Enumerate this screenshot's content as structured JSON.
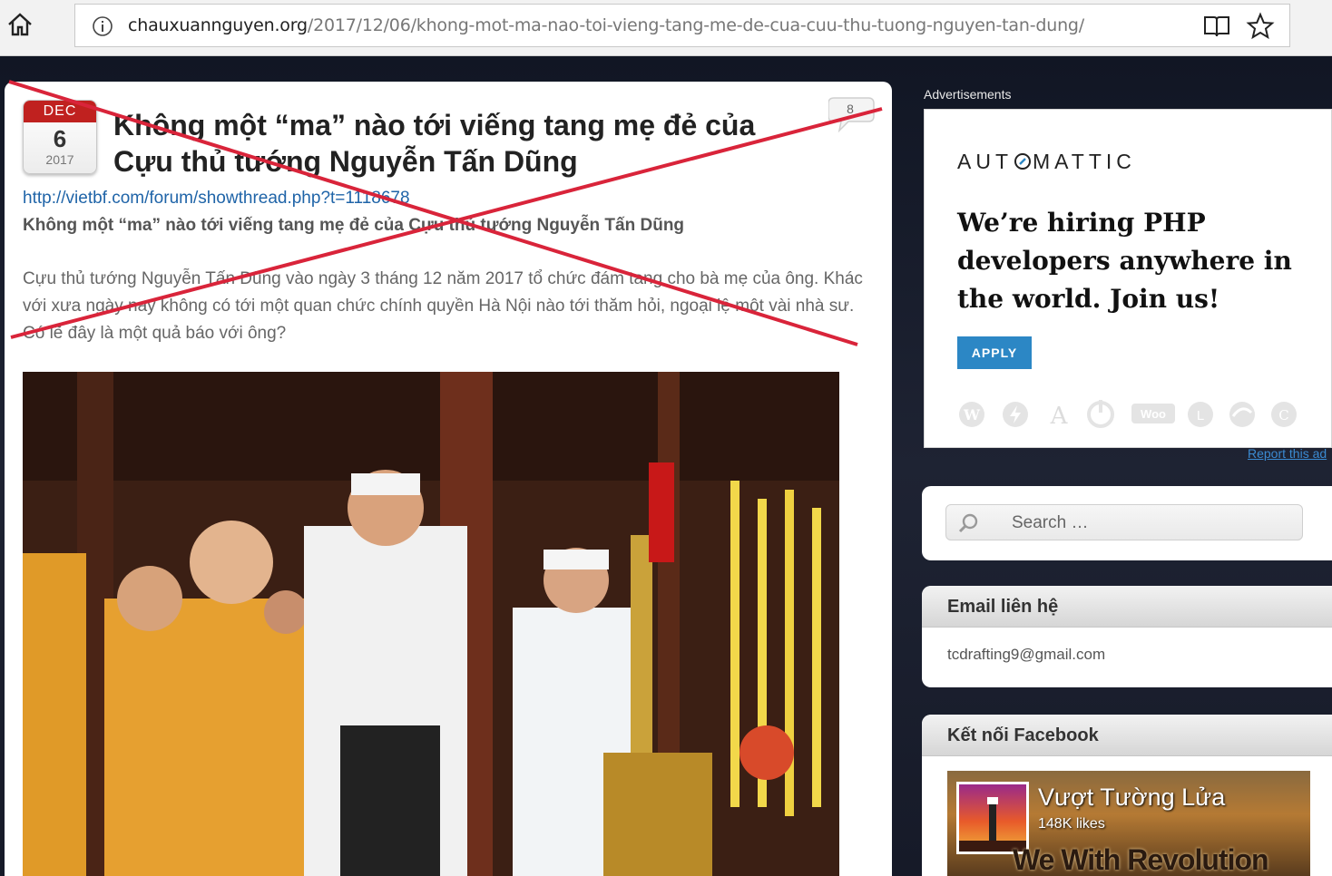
{
  "browser": {
    "url_domain": "chauxuannguyen.org",
    "url_path": "/2017/12/06/khong-mot-ma-nao-toi-vieng-tang-me-de-cua-cuu-thu-tuong-nguyen-tan-dung/"
  },
  "post": {
    "date": {
      "month": "DEC",
      "day": "6",
      "year": "2017"
    },
    "title": "Không một “ma” nào tới viếng tang mẹ đẻ của Cựu thủ tướng Nguyễn Tấn Dũng",
    "comment_count": "8",
    "source_link": "http://vietbf.com/forum/showthread.php?t=1118678",
    "subtitle": "Không một “ma” nào tới viếng tang mẹ đẻ của Cựu thủ tướng Nguyễn Tấn Dũng",
    "body": "Cựu thủ tướng Nguyễn Tấn Dũng vào ngày 3 tháng 12 năm 2017 tổ chức đám tang cho bà mẹ của ông. Khác với xưa ngày nay không có tới một quan chức chính quyền Hà Nội nào tới thăm hỏi, ngoại lệ một vài nhà sư. Có lẽ đây là một quả báo với ông?"
  },
  "sidebar": {
    "ads_label": "Advertisements",
    "ad": {
      "brand_left": "AUT",
      "brand_right": "MATTIC",
      "headline": "We’re hiring PHP developers anywhere in the world. Join us!",
      "apply_label": "APPLY",
      "report_link": "Report this ad"
    },
    "search": {
      "placeholder": "Search …"
    },
    "email_widget": {
      "title": "Email liên hệ",
      "email": "tcdrafting9@gmail.com"
    },
    "facebook_widget": {
      "title": "Kết nối Facebook",
      "page_name": "Vượt Tường Lửa",
      "likes": "148K likes",
      "cover_text": "We With Revolution"
    }
  },
  "colors": {
    "accent_red": "#c0211f",
    "link_blue": "#1f64a8",
    "apply_blue": "#2c87c5",
    "cross_red": "#d9243a"
  }
}
